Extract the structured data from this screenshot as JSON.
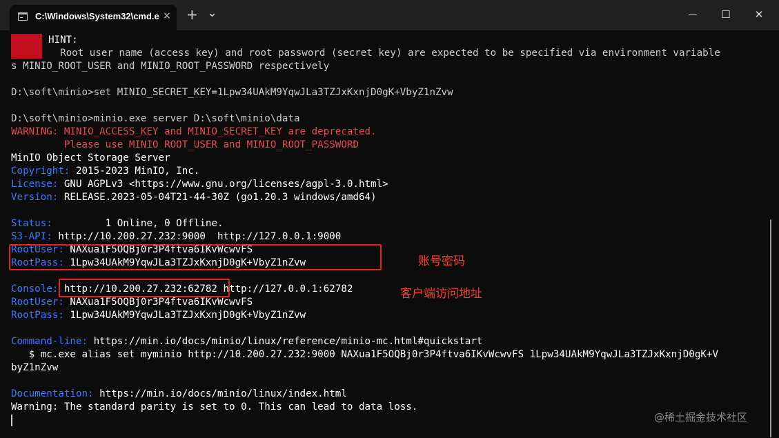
{
  "titlebar": {
    "tab_title": "C:\\Windows\\System32\\cmd.e",
    "tab_close": "×",
    "new_tab": "+",
    "dropdown": "⌄",
    "minimize": "—",
    "maximize": "☐",
    "close": "✕"
  },
  "console": {
    "hint_label": "HINT:",
    "hint_line1": "  Root user name (access key) and root password (secret key) are expected to be specified via environment variable",
    "hint_line2": "s MINIO_ROOT_USER and MINIO_ROOT_PASSWORD respectively",
    "cmd_set": "D:\\soft\\minio>set MINIO_SECRET_KEY=1Lpw34UAkM9YqwJLa3TZJxKxnjD0gK+VbyZ1nZvw",
    "cmd_server": "D:\\soft\\minio>minio.exe server D:\\soft\\minio\\data",
    "warning_line1": "WARNING: MINIO_ACCESS_KEY and MINIO_SECRET_KEY are deprecated.",
    "warning_line2": "         Please use MINIO_ROOT_USER and MINIO_ROOT_PASSWORD",
    "product": "MinIO Object Storage Server",
    "copyright_key": "Copyright:",
    "copyright_val": " 2015-2023 MinIO, Inc.",
    "license_key": "License:",
    "license_val": " GNU AGPLv3 <https://www.gnu.org/licenses/agpl-3.0.html>",
    "version_key": "Version:",
    "version_val": " RELEASE.2023-05-04T21-44-30Z (go1.20.3 windows/amd64)",
    "status_key": "Status:",
    "status_val": "         1 Online, 0 Offline.",
    "s3api_key": "S3-API:",
    "s3api_val": " http://10.200.27.232:9000  http://127.0.0.1:9000",
    "rootuser_key": "RootUser:",
    "rootuser_val": " NAXua1F5OQBj0r3P4ftva6IKvWcwvFS",
    "rootpass_key": "RootPass:",
    "rootpass_val": " 1Lpw34UAkM9YqwJLa3TZJxKxnjD0gK+VbyZ1nZvw",
    "console_key": "Console:",
    "console_val": " http://10.200.27.232:62782 http://127.0.0.1:62782",
    "rootuser2_key": "RootUser:",
    "rootuser2_val": " NAXua1F5OQBj0r3P4ftva6IKvWcwvFS",
    "rootpass2_key": "RootPass:",
    "rootpass2_val": " 1Lpw34UAkM9YqwJLa3TZJxKxnjD0gK+VbyZ1nZvw",
    "cmdline_key": "Command-line:",
    "cmdline_val": " https://min.io/docs/minio/linux/reference/minio-mc.html#quickstart",
    "mc_line1": "   $ mc.exe alias set myminio http://10.200.27.232:9000 NAXua1F5OQBj0r3P4ftva6IKvWcwvFS 1Lpw34UAkM9YqwJLa3TZJxKxnjD0gK+V",
    "mc_line2": "byZ1nZvw",
    "doc_key": "Documentation:",
    "doc_val": " https://min.io/docs/minio/linux/index.html",
    "final_warning": "Warning: The standard parity is set to 0. This can lead to data loss."
  },
  "annotations": {
    "credentials": "账号密码",
    "client_url": "客户端访问地址"
  },
  "watermark": "@稀土掘金技术社区"
}
